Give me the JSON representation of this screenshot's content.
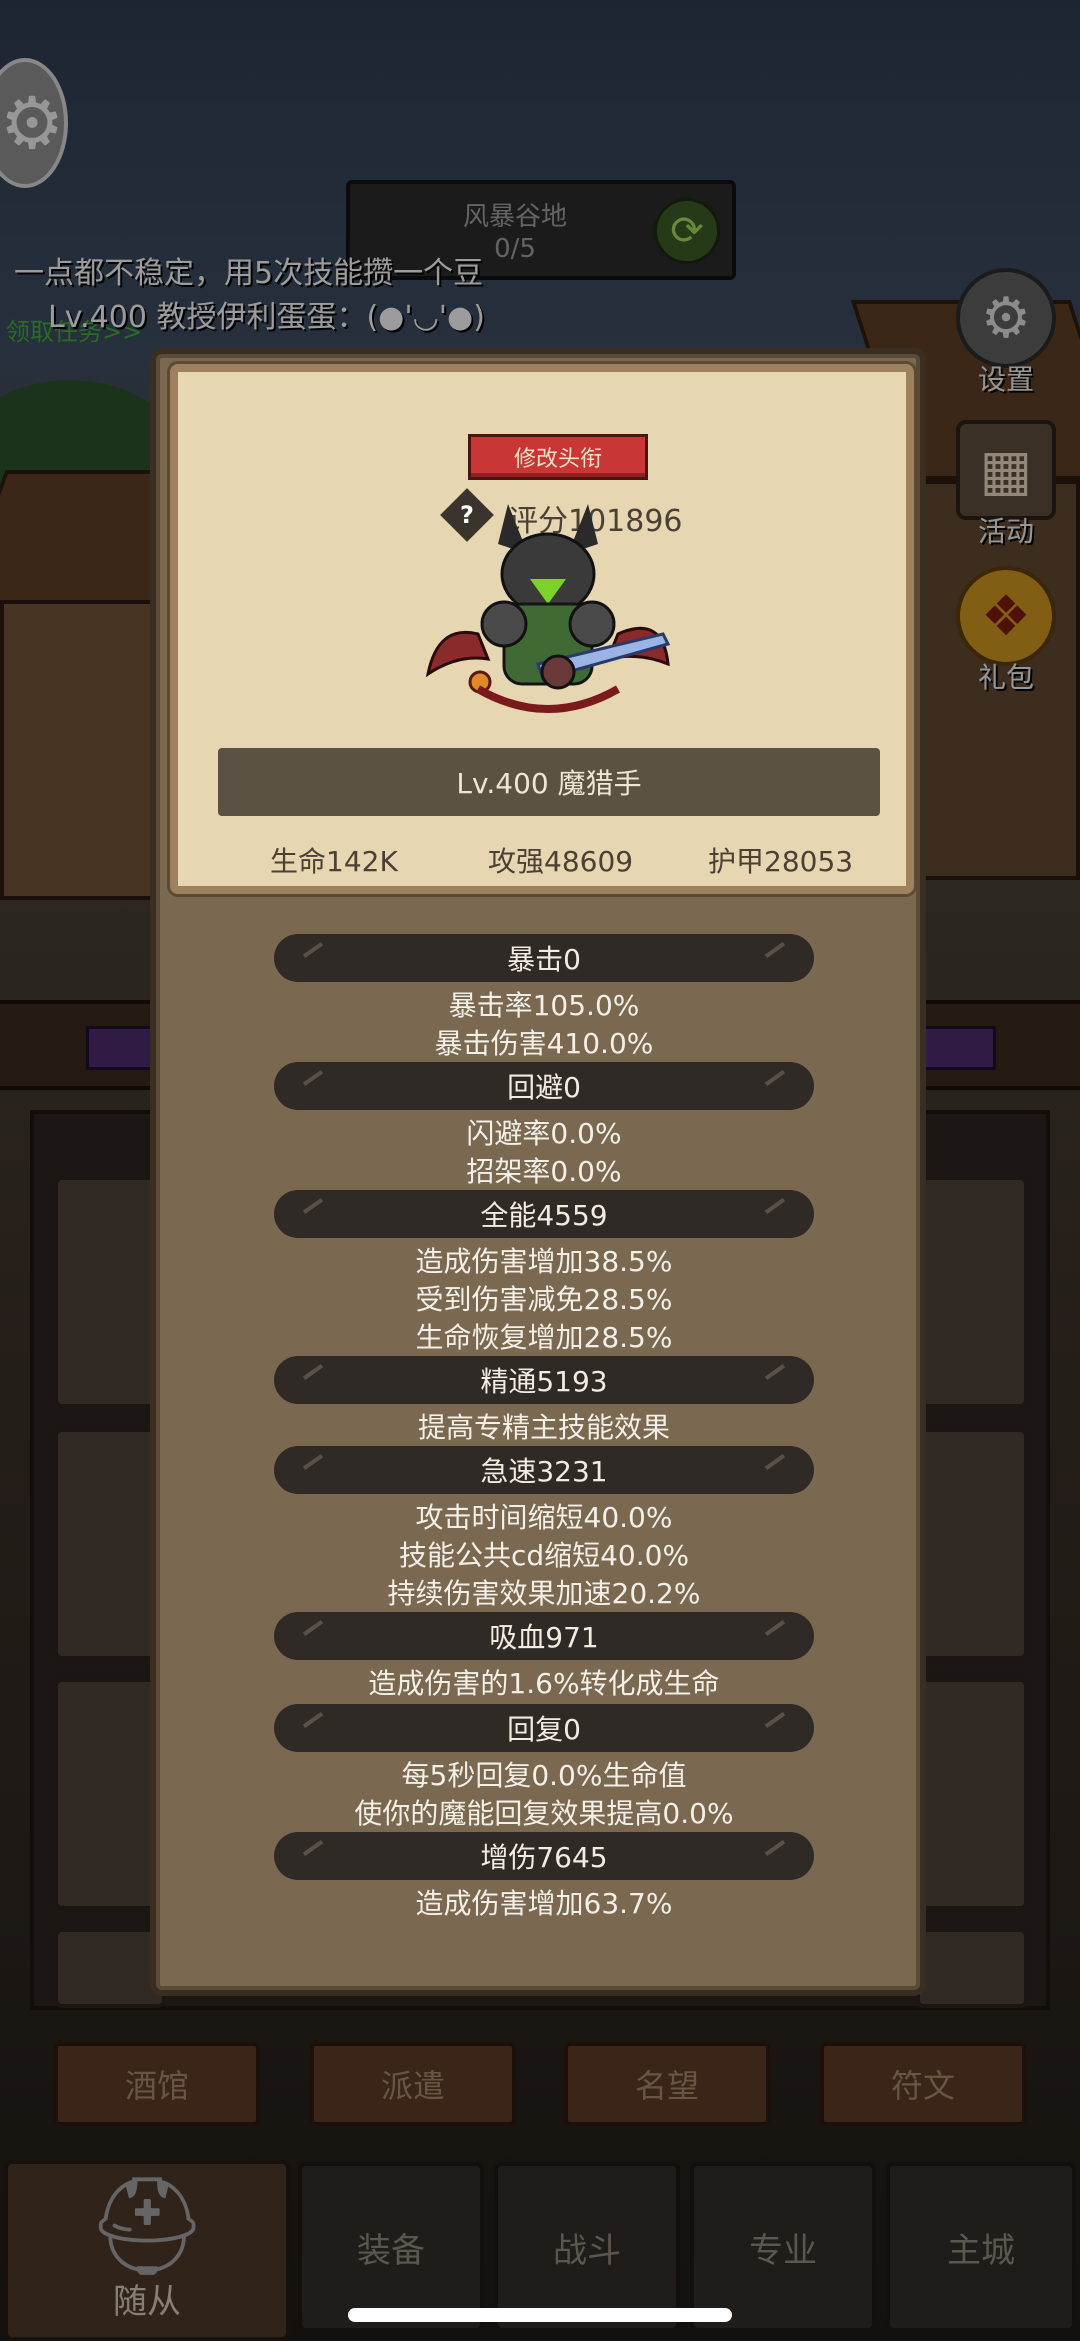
{
  "top_hud": {
    "zone": {
      "name": "风暴谷地",
      "progress": "0/5"
    },
    "quest_lines": [
      "一点都不稳定，用5次技能攒一个豆",
      "Lv.400 教授伊利蛋蛋：(●'◡'●)",
      "领取任务>>"
    ]
  },
  "side_menu": [
    {
      "label": "设置",
      "icon": "gear-icon"
    },
    {
      "label": "活动",
      "icon": "calendar-icon"
    },
    {
      "label": "礼包",
      "icon": "gift-icon"
    }
  ],
  "popup": {
    "title_button": "修改头衔",
    "score": "评分101896",
    "hero_name": "Lv.400 魔猎手",
    "core_stats": {
      "hp": "生命142K",
      "attack": "攻强48609",
      "armor": "护甲28053"
    },
    "attribute_groups": [
      {
        "header": "暴击0",
        "lines": [
          "暴击率105.0%",
          "暴击伤害410.0%"
        ]
      },
      {
        "header": "回避0",
        "lines": [
          "闪避率0.0%",
          "招架率0.0%"
        ]
      },
      {
        "header": "全能4559",
        "lines": [
          "造成伤害增加38.5%",
          "受到伤害减免28.5%",
          "生命恢复增加28.5%"
        ]
      },
      {
        "header": "精通5193",
        "lines": [
          "提高专精主技能效果"
        ]
      },
      {
        "header": "急速3231",
        "lines": [
          "攻击时间缩短40.0%",
          "技能公共cd缩短40.0%",
          "持续伤害效果加速20.2%"
        ]
      },
      {
        "header": "吸血971",
        "lines": [
          "造成伤害的1.6%转化成生命"
        ]
      },
      {
        "header": "回复0",
        "lines": [
          "每5秒回复0.0%生命值",
          "使你的魔能回复效果提高0.0%"
        ]
      },
      {
        "header": "增伤7645",
        "lines": [
          "造成伤害增加63.7%"
        ]
      }
    ]
  },
  "sub_tabs": [
    "酒馆",
    "派遣",
    "名望",
    "符文"
  ],
  "bottom_nav": [
    "随从",
    "装备",
    "战斗",
    "专业",
    "主城"
  ]
}
